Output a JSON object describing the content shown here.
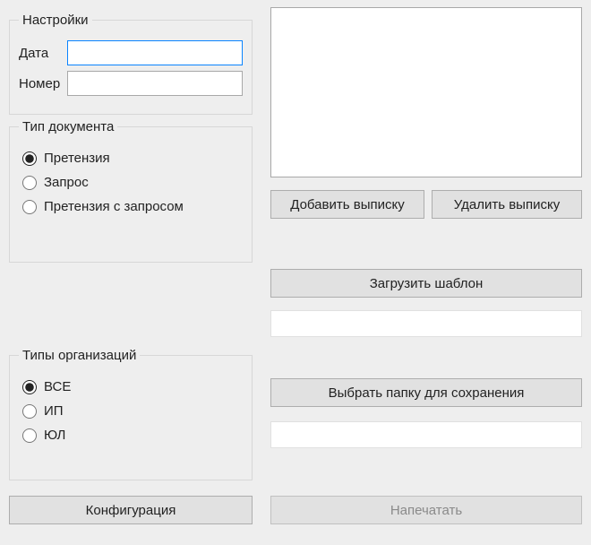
{
  "settings": {
    "legend": "Настройки",
    "date_label": "Дата",
    "date_value": "",
    "number_label": "Номер",
    "number_value": ""
  },
  "doc_type": {
    "legend": "Тип документа",
    "options": [
      {
        "label": "Претензия",
        "checked": true
      },
      {
        "label": "Запрос",
        "checked": false
      },
      {
        "label": "Претензия с запросом",
        "checked": false
      }
    ]
  },
  "org_type": {
    "legend": "Типы организаций",
    "options": [
      {
        "label": "ВСЕ",
        "checked": true
      },
      {
        "label": "ИП",
        "checked": false
      },
      {
        "label": "ЮЛ",
        "checked": false
      }
    ]
  },
  "config_button": "Конфигурация",
  "extract_list": [],
  "add_extract_button": "Добавить выписку",
  "delete_extract_button": "Удалить выписку",
  "load_template_button": "Загрузить шаблон",
  "template_path": "",
  "choose_folder_button": "Выбрать папку для сохранения",
  "folder_path": "",
  "print_button": "Напечатать",
  "print_enabled": false
}
